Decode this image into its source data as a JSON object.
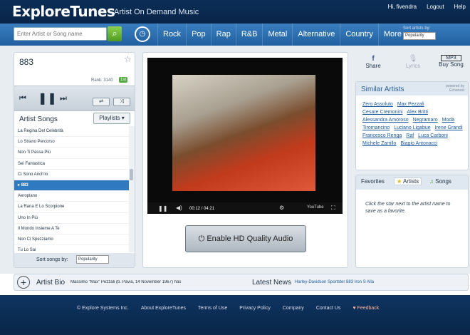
{
  "header": {
    "logo": "ExploreTunes",
    "tagline": "Artist On Demand Music",
    "user": "Hi, fivendra",
    "logout": "Logout",
    "help": "Help"
  },
  "nav": {
    "search_placeholder": "Enter Artist or Song name",
    "genres": [
      "Rock",
      "Pop",
      "Rap",
      "R&B",
      "Metal",
      "Alternative",
      "Country",
      "More"
    ],
    "sort_label": "Sort artists by:",
    "sort_value": "Popularity"
  },
  "left": {
    "song_title": "883",
    "rank": "Rank: 3140",
    "badge": "1st",
    "artist_songs": "Artist Songs",
    "playlists": "Playlists",
    "sort_label": "Sort songs by:",
    "sort_value": "Popularity",
    "songs": [
      "La Regina Del Celebrità",
      "Lo Strano Percorso",
      "Non Ti Passa Più",
      "Sei Fantastica",
      "Ci Sono Anch'io",
      "883",
      "Aeroplano",
      "La Rana E Lo Scorpione",
      "Uno In Più",
      "Il Mondo Insieme A Te",
      "Non Ci Spezziamo",
      "Tu Lo Sai"
    ]
  },
  "video": {
    "time": "00:12 / 04:21",
    "hd_button": "Enable HD Quality Audio"
  },
  "right": {
    "share": "Share",
    "lyrics": "Lyrics",
    "buy": "Buy Song",
    "mp3": "MP3",
    "similar_title": "Similar Artists",
    "powered": "powered by Echonest",
    "similar": [
      "Zero Assoluto",
      "Max Pezzali",
      "Cesare Cremonini",
      "Alex Britti",
      "Alessandra Amoroso",
      "Negramaro",
      "Modà",
      "Tiromancino",
      "Luciano Ligabue",
      "Irene Grandi",
      "Francesco Renga",
      "Raf",
      "Luca Carboni",
      "Michele Zarrillo",
      "Biagio Antonacci"
    ],
    "tabs": [
      "Favorites",
      "Artists",
      "Songs"
    ],
    "fav_msg": "Click the star next to the artist name to save as a favorite."
  },
  "bottom": {
    "bio_label": "Artist Bio",
    "bio_text": "Massimo \"Max\" Pezzali (b. Pavia, 14 November 1967) has",
    "news_label": "Latest News",
    "news_text": "Harley-Davidson Sportster 883 Iron S    Alla"
  },
  "footer": [
    "© Explore Systems Inc.",
    "About ExploreTunes",
    "Terms of Use",
    "Privacy Policy",
    "Company",
    "Contact Us",
    "♥ Feedback"
  ]
}
